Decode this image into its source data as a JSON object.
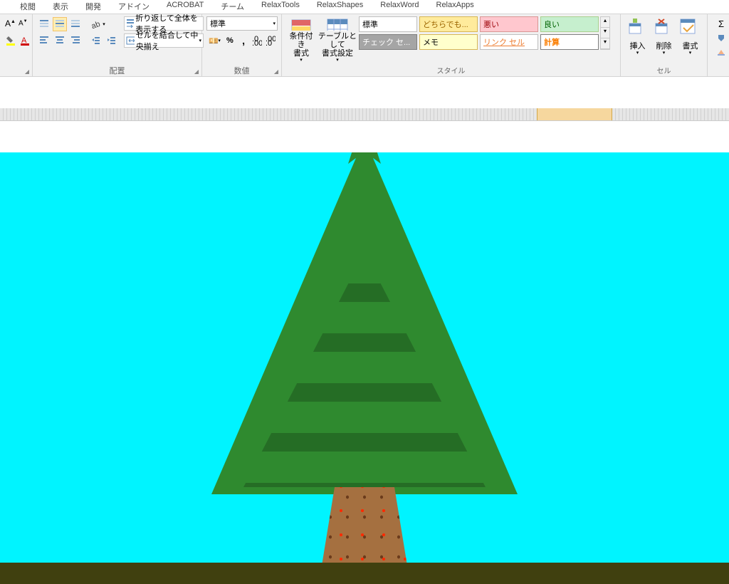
{
  "tabs": [
    "校閲",
    "表示",
    "開発",
    "アドイン",
    "ACROBAT",
    "チーム",
    "RelaxTools",
    "RelaxShapes",
    "RelaxWord",
    "RelaxApps"
  ],
  "font_group": {
    "grow": "A",
    "shrink": "A"
  },
  "alignment": {
    "wrap": "折り返して全体を表示する",
    "merge": "セルを結合して中央揃え",
    "label": "配置"
  },
  "number": {
    "format": "標準",
    "label": "数値",
    "percent": "%",
    "comma": ","
  },
  "styles": {
    "cond": "条件付き\n書式",
    "table": "テーブルとして\n書式設定",
    "gallery": {
      "normal": "標準",
      "neutral": "どちらでも...",
      "bad": "悪い",
      "good": "良い",
      "check": "チェック セ...",
      "memo": "メモ",
      "link": "リンク セル",
      "calc": "計算"
    },
    "label": "スタイル"
  },
  "cells": {
    "insert": "挿入",
    "delete": "削除",
    "format": "書式",
    "label": "セル"
  }
}
